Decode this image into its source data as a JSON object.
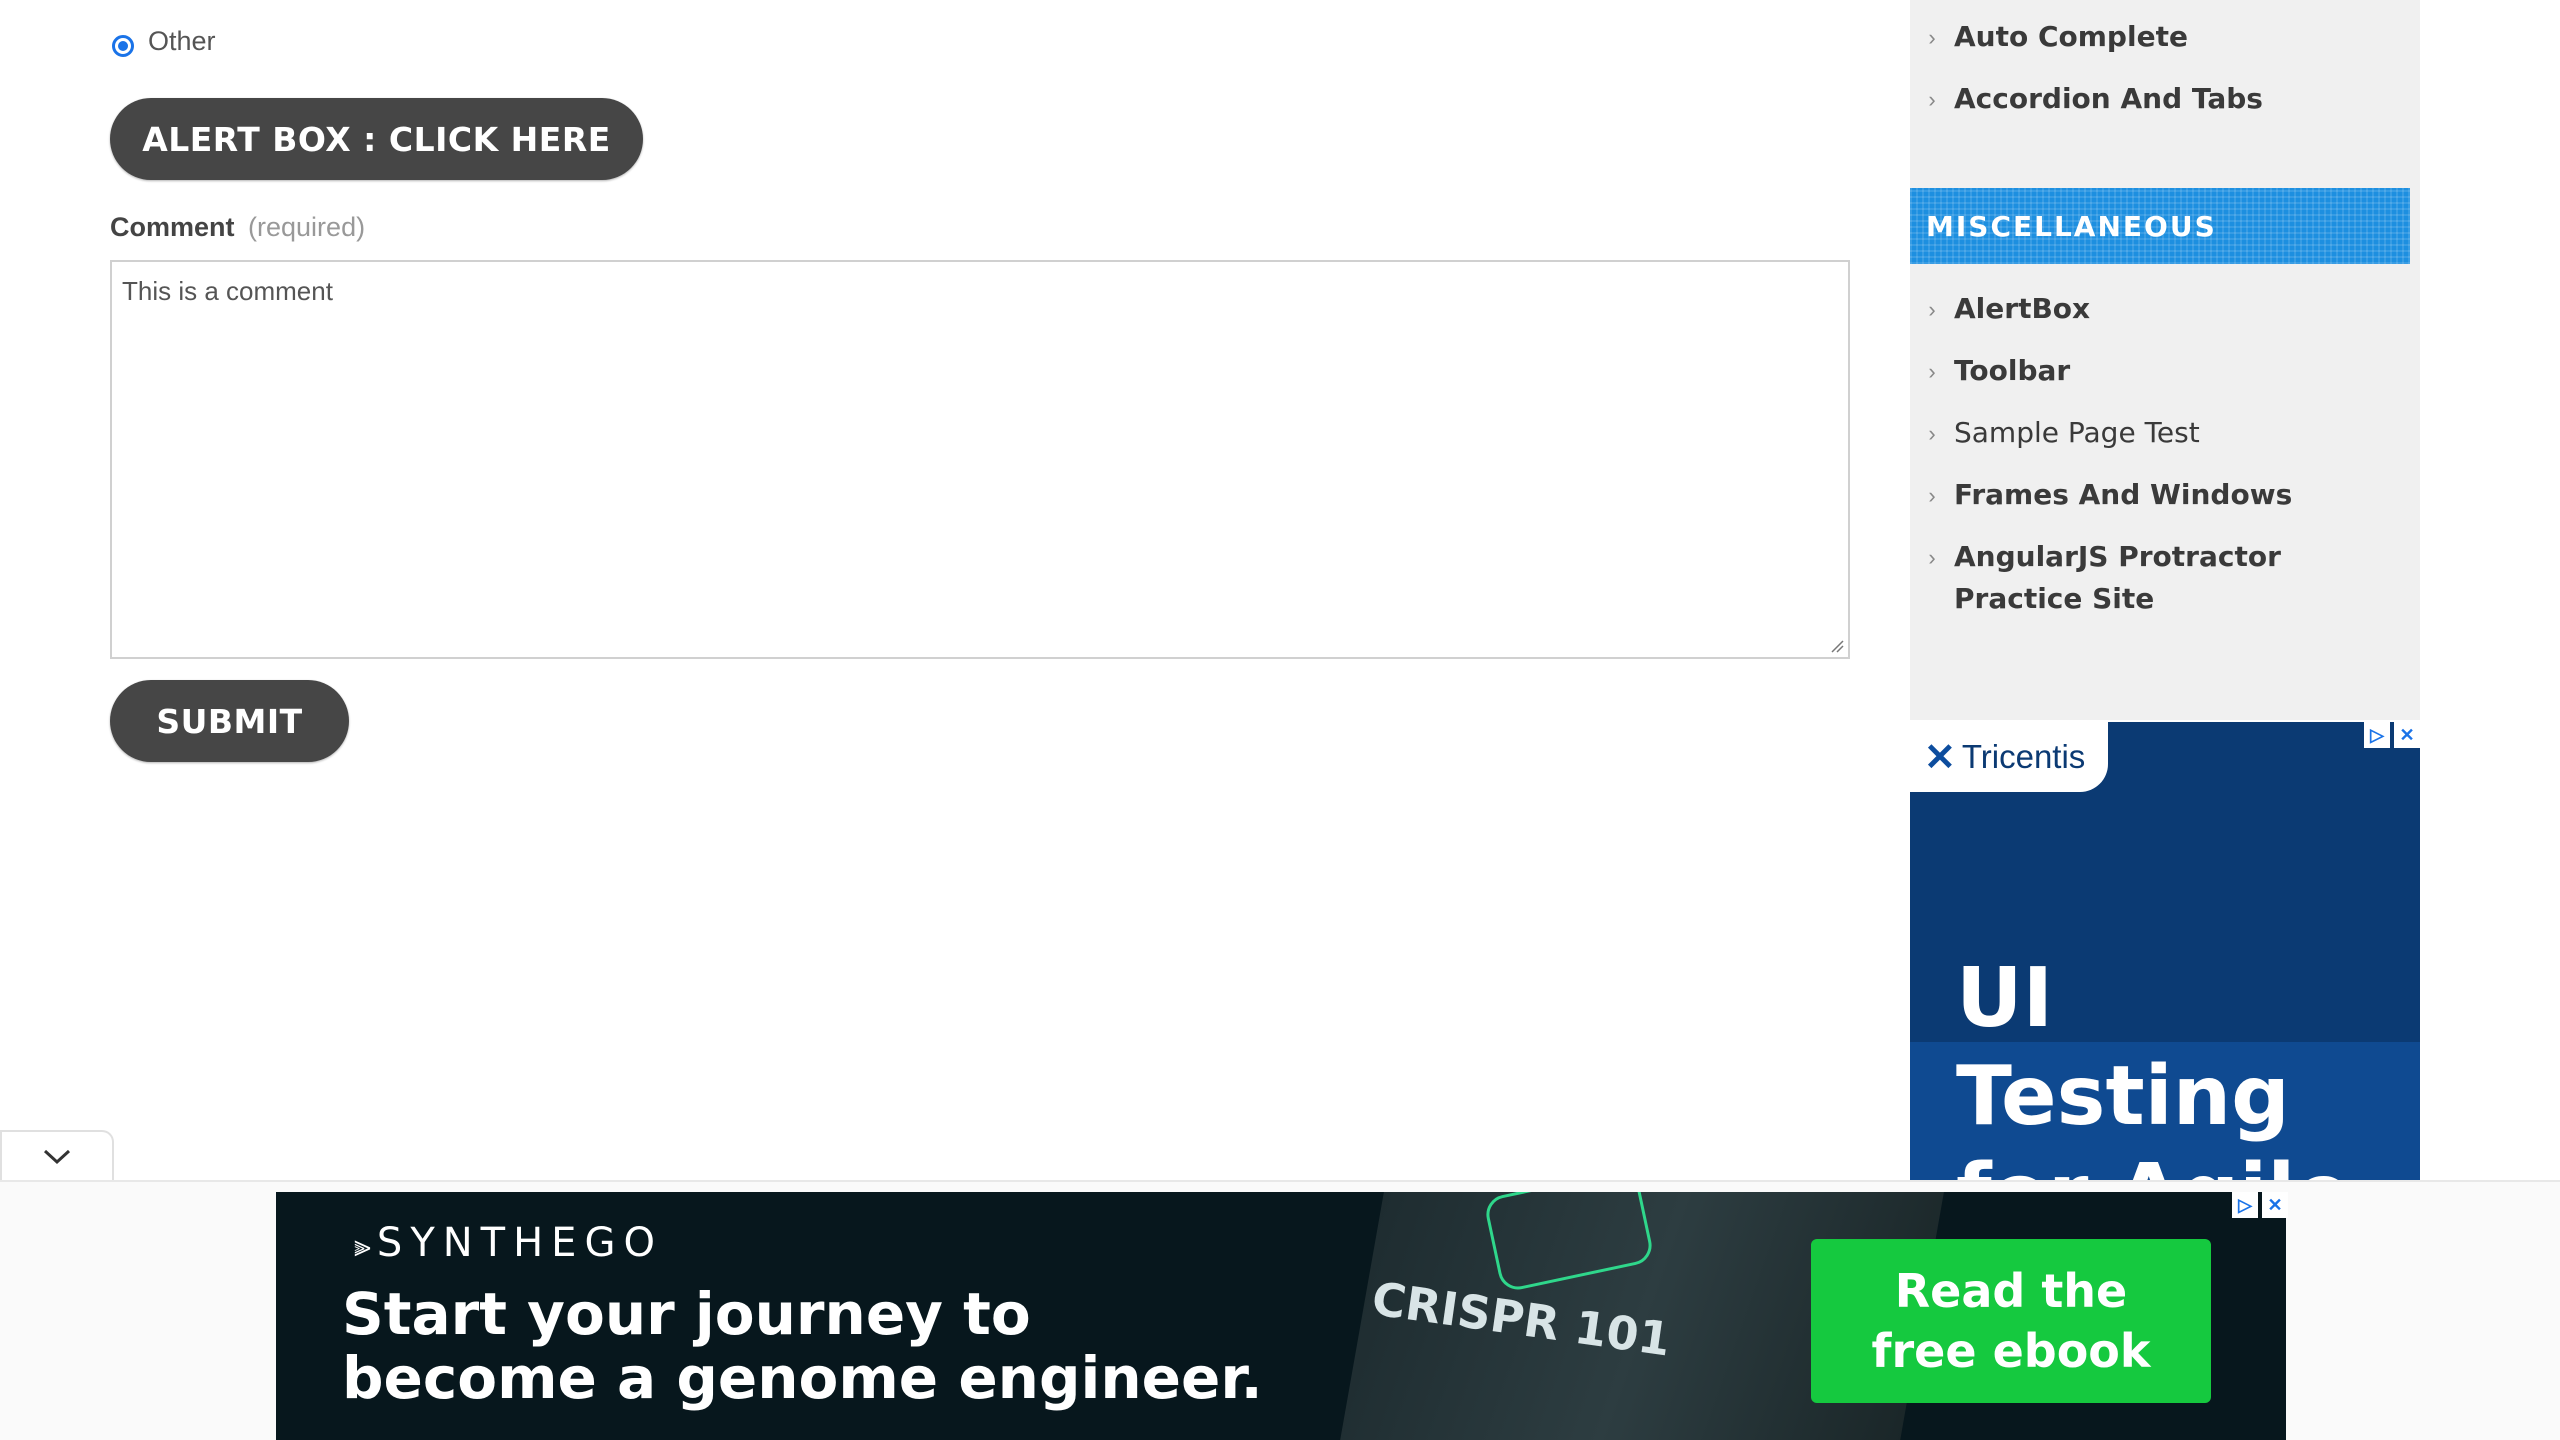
{
  "form": {
    "radio_other_label": "Other",
    "alert_button_label": "ALERT BOX : CLICK HERE",
    "comment_label": "Comment",
    "comment_required": "(required)",
    "comment_value": "This is a comment",
    "submit_label": "SUBMIT"
  },
  "sidebar": {
    "top_items": [
      {
        "label": "Auto Complete"
      },
      {
        "label": "Accordion And Tabs"
      }
    ],
    "misc_header": "MISCELLANEOUS",
    "misc_items": [
      {
        "label": "AlertBox"
      },
      {
        "label": "Toolbar"
      },
      {
        "label": "Sample Page Test"
      },
      {
        "label": "Frames And Windows"
      },
      {
        "label": "AngularJS Protractor Practice Site"
      }
    ]
  },
  "side_ad": {
    "brand": "Tricentis",
    "headline": "UI Testing for Agile",
    "colors": {
      "background": "#0b3a73",
      "band": "#0f4a91"
    }
  },
  "bottom_ad": {
    "brand": "SYNTHEGO",
    "tagline_line1": "Start your journey to",
    "tagline_line2": "become a genome engineer.",
    "book_title": "CRISPR 101",
    "cta": "Read the free ebook",
    "colors": {
      "background": "#07171d",
      "cta": "#15c93f"
    }
  },
  "icons": {
    "radio": "radio-selected-icon",
    "chevron": "chevron-right-icon",
    "collapse": "chevron-down-icon",
    "ad_choices": "adchoices-icon",
    "close": "close-icon"
  },
  "colors": {
    "accent": "#1a73e8",
    "button": "#464646",
    "sidebar_bg": "#f0f0f0",
    "misc_header": "#1d8fe0"
  }
}
